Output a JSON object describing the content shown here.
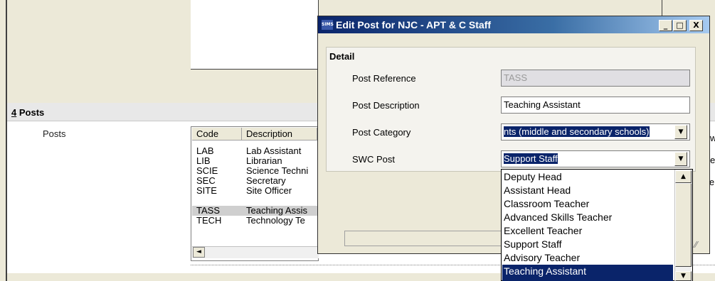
{
  "posts_section": {
    "header_number": "4",
    "header_text": " Posts",
    "label": "Posts"
  },
  "posts_table": {
    "columns": [
      "Code",
      "Description"
    ],
    "rows": [
      {
        "code": "LAB",
        "description": "Lab Assistant"
      },
      {
        "code": "LIB",
        "description": "Librarian"
      },
      {
        "code": "SCIE",
        "description": "Science Techni"
      },
      {
        "code": "SEC",
        "description": "Secretary"
      },
      {
        "code": "SITE",
        "description": "Site Officer"
      },
      {
        "code": "TASS",
        "description": "Teaching Assis"
      },
      {
        "code": "TECH",
        "description": "Technology Te"
      }
    ],
    "selected_code": "TASS",
    "scroll_left_arrow": "◄"
  },
  "edge_crumbs": [
    "w",
    "e",
    "le"
  ],
  "dialog": {
    "icon_text": "SIMS",
    "title": "Edit Post for NJC - APT & C Staff",
    "minimize": "_",
    "maximize": "□",
    "close": "X",
    "group_title": "Detail",
    "fields": {
      "ref_label": "Post Reference",
      "ref_value": "TASS",
      "desc_label": "Post Description",
      "desc_value": "Teaching Assistant",
      "cat_label": "Post Category",
      "cat_value": "nts (middle and secondary schools)",
      "swc_label": "SWC Post",
      "swc_value": "Support Staff"
    },
    "dropdown_arrow": "▼",
    "grip": "⁄⁄"
  },
  "swc_dropdown": {
    "options": [
      "Deputy Head",
      "Assistant Head",
      "Classroom Teacher",
      "Advanced Skills Teacher",
      "Excellent Teacher",
      "Support Staff",
      "Advisory Teacher",
      "Teaching Assistant"
    ],
    "selected_index": 7,
    "up_arrow": "▲",
    "down_arrow": "▼"
  }
}
